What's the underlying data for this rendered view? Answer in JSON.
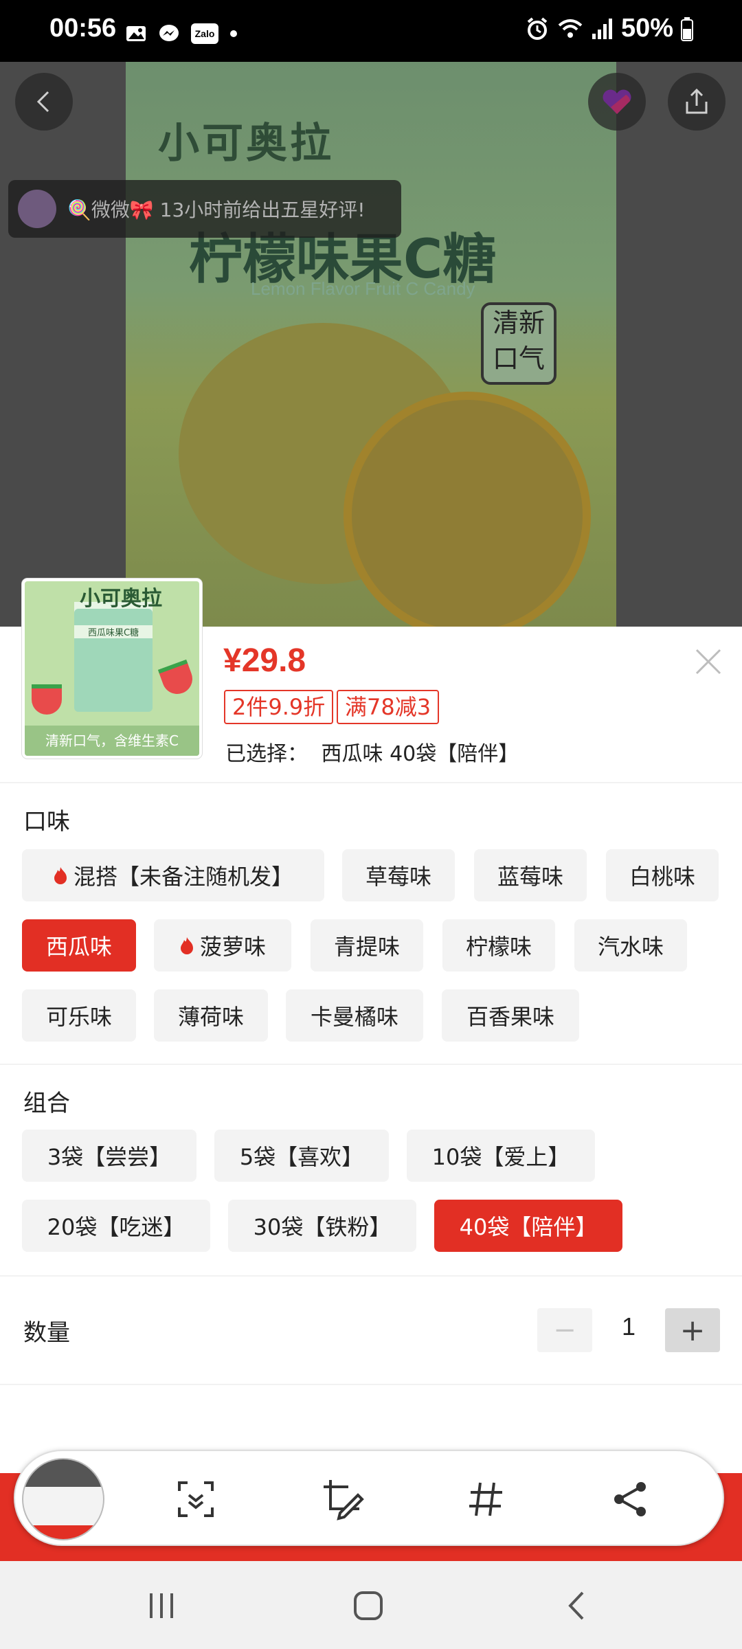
{
  "status_bar": {
    "time": "00:56",
    "battery": "50%",
    "icons_left": [
      "gallery-icon",
      "messenger-icon",
      "zalo-icon",
      "dot-icon"
    ],
    "icons_right": [
      "alarm-icon",
      "wifi-icon",
      "signal-icon",
      "battery-icon"
    ],
    "zalo_label": "Zalo"
  },
  "hero": {
    "brand_text": "小可奥拉",
    "product_title": "柠檬味果C糖",
    "product_subtitle_en": "Lemon Flavor Fruit C Candy",
    "badge_text": "清新口气",
    "toast_text": "🍭微微🎀 13小时前给出五星好评!"
  },
  "sheet": {
    "price": "¥29.8",
    "promos": [
      "2件9.9折",
      "满78减3"
    ],
    "selected_label": "已选择：",
    "selected_value": "西瓜味 40袋【陪伴】",
    "thumbnail": {
      "title": "小可奥拉",
      "pack_text": "西瓜味果C糖",
      "band_text": "清新口气，含维生素C"
    }
  },
  "flavor": {
    "title": "口味",
    "options": [
      {
        "label": "混搭【未备注随机发】",
        "hot": true,
        "selected": false
      },
      {
        "label": "草莓味",
        "hot": false,
        "selected": false
      },
      {
        "label": "蓝莓味",
        "hot": false,
        "selected": false
      },
      {
        "label": "白桃味",
        "hot": false,
        "selected": false
      },
      {
        "label": "西瓜味",
        "hot": false,
        "selected": true
      },
      {
        "label": "菠萝味",
        "hot": true,
        "selected": false
      },
      {
        "label": "青提味",
        "hot": false,
        "selected": false
      },
      {
        "label": "柠檬味",
        "hot": false,
        "selected": false
      },
      {
        "label": "汽水味",
        "hot": false,
        "selected": false
      },
      {
        "label": "可乐味",
        "hot": false,
        "selected": false
      },
      {
        "label": "薄荷味",
        "hot": false,
        "selected": false
      },
      {
        "label": "卡曼橘味",
        "hot": false,
        "selected": false
      },
      {
        "label": "百香果味",
        "hot": false,
        "selected": false
      }
    ]
  },
  "bundle": {
    "title": "组合",
    "options": [
      {
        "label": "3袋【尝尝】",
        "selected": false
      },
      {
        "label": "5袋【喜欢】",
        "selected": false
      },
      {
        "label": "10袋【爱上】",
        "selected": false
      },
      {
        "label": "20袋【吃迷】",
        "selected": false
      },
      {
        "label": "30袋【铁粉】",
        "selected": false
      },
      {
        "label": "40袋【陪伴】",
        "selected": true
      }
    ]
  },
  "quantity": {
    "label": "数量",
    "value": "1",
    "minus": "−",
    "plus": "+"
  },
  "colors": {
    "accent": "#e22f24",
    "chip_bg": "#f3f3f3",
    "status_bar": "#000000"
  }
}
